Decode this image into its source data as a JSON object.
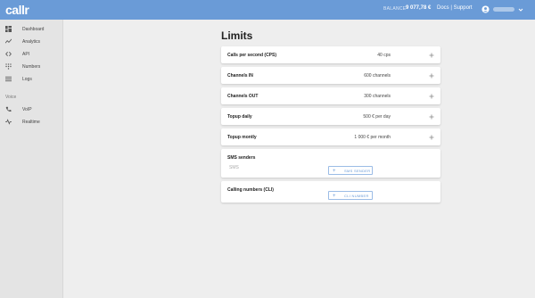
{
  "header": {
    "logo_text": "callr",
    "balance_label": "BALANCE",
    "balance_value": "9 077,78 €",
    "docs_link": "Docs | Support",
    "accent_color": "#6a9bd7"
  },
  "sidebar": {
    "items": [
      {
        "label": "Dashboard",
        "icon": "dashboard-icon"
      },
      {
        "label": "Analytics",
        "icon": "analytics-icon"
      },
      {
        "label": "API",
        "icon": "code-icon"
      },
      {
        "label": "Numbers",
        "icon": "dialpad-icon"
      },
      {
        "label": "Logs",
        "icon": "list-icon"
      }
    ],
    "section_voice": "Voice",
    "voice_items": [
      {
        "label": "VoIP",
        "icon": "phone-icon"
      },
      {
        "label": "Realtime",
        "icon": "realtime-icon"
      }
    ]
  },
  "main": {
    "title": "Limits",
    "limits": [
      {
        "label": "Calls per second (CPS)",
        "value": "40 cps"
      },
      {
        "label": "Channels IN",
        "value": "600 channels"
      },
      {
        "label": "Channels OUT",
        "value": "300 channels"
      },
      {
        "label": "Topup daily",
        "value": "500 € per day"
      },
      {
        "label": "Topup montly",
        "value": "1 000 € per month"
      }
    ],
    "sms_senders": {
      "label": "SMS senders",
      "placeholder": "SMS",
      "button_label": "SMS SENDER"
    },
    "calling_numbers": {
      "label": "Calling numbers (CLI)",
      "button_label": "CLI NUMBER"
    }
  }
}
